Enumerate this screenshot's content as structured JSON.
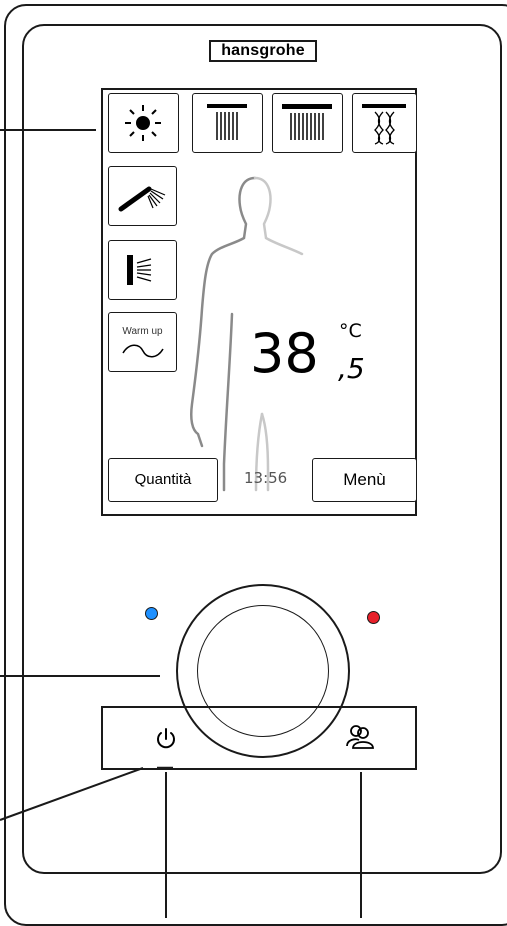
{
  "brand": {
    "logo_text": "hansgrohe"
  },
  "screen": {
    "top_buttons": [
      {
        "icon": "sun-icon"
      },
      {
        "icon": "overhead-shower-narrow-icon"
      },
      {
        "icon": "overhead-shower-wide-icon"
      },
      {
        "icon": "overhead-shower-mix-icon"
      }
    ],
    "side_buttons": [
      {
        "icon": "hand-shower-icon"
      },
      {
        "icon": "side-jet-icon"
      },
      {
        "icon": "wave-icon",
        "label": "Warm up"
      }
    ],
    "temperature": {
      "integer": "38",
      "decimal": ",5",
      "unit": "°C"
    },
    "clock": "13:56",
    "quantity_label": "Quantità",
    "menu_label": "Menù"
  },
  "dial": {
    "cold_color": "#1e90ff",
    "hot_color": "#e8202a"
  },
  "controls": {
    "power_icon": "power-icon",
    "user_icon": "users-icon"
  }
}
